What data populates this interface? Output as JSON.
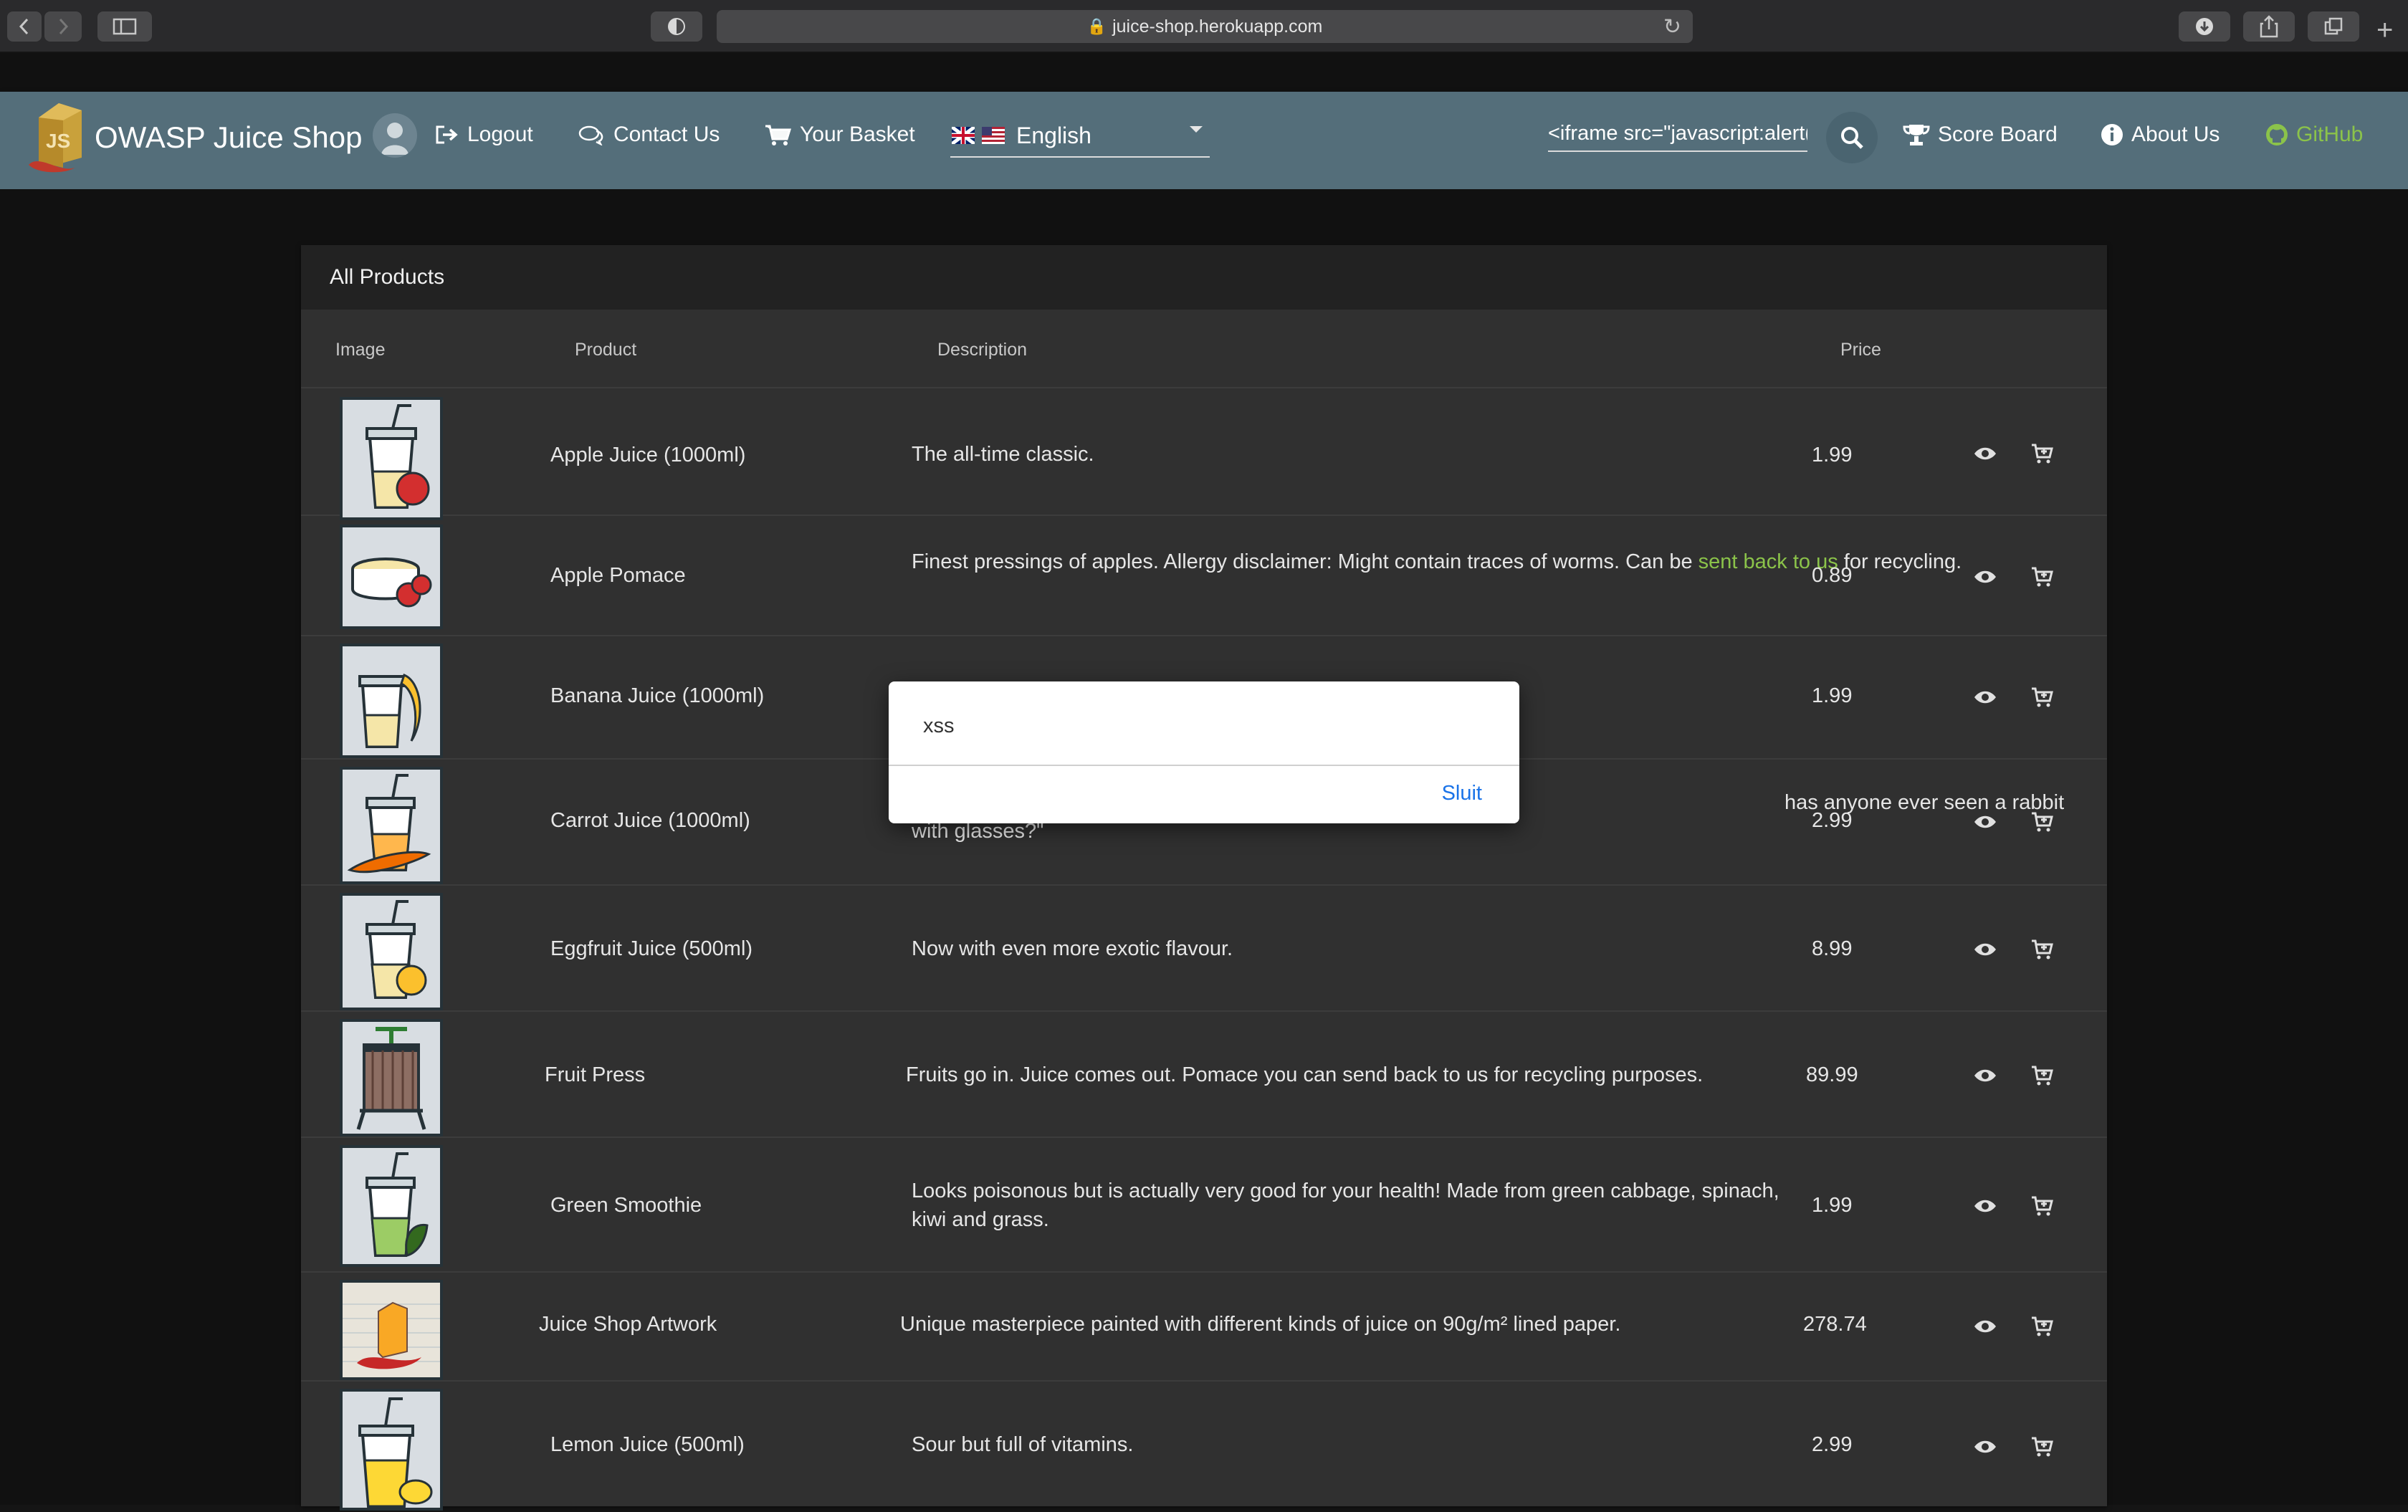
{
  "browser": {
    "url": "juice-shop.herokuapp.com"
  },
  "navbar": {
    "brand": "OWASP Juice Shop",
    "logout": "Logout",
    "contact": "Contact Us",
    "basket": "Your Basket",
    "language": "English",
    "search_value": "<iframe src=\"javascript:alert(",
    "score_board": "Score Board",
    "about": "About Us",
    "github": "GitHub"
  },
  "products": {
    "title": "All Products",
    "headers": [
      "Image",
      "Product",
      "Description",
      "Price"
    ],
    "rows": [
      {
        "name": "Apple Juice (1000ml)",
        "desc": "The all-time classic.",
        "price": "1.99"
      },
      {
        "name": "Apple Pomace",
        "desc": "Finest pressings of apples. Allergy disclaimer: Might contain traces of worms. Can be ",
        "desc_link": "sent back to us",
        "desc_after": " for recycling.",
        "price": "0.89"
      },
      {
        "name": "Banana Juice (1000ml)",
        "desc": "",
        "price": "1.99"
      },
      {
        "name": "Carrot Juice (1000ml)",
        "desc": "has anyone ever seen a rabbit",
        "desc_line2": "with glasses?\"",
        "price": "2.99"
      },
      {
        "name": "Eggfruit Juice (500ml)",
        "desc": "Now with even more exotic flavour.",
        "price": "8.99"
      },
      {
        "name": "Fruit Press",
        "desc": "Fruits go in. Juice comes out. Pomace you can send back to us for recycling purposes.",
        "price": "89.99"
      },
      {
        "name": "Green Smoothie",
        "desc": "Looks poisonous but is actually very good for your health! Made from green cabbage, spinach, kiwi and grass.",
        "price": "1.99"
      },
      {
        "name": "Juice Shop Artwork",
        "desc": "Unique masterpiece painted with different kinds of juice on 90g/m² lined paper.",
        "price": "278.74"
      },
      {
        "name": "Lemon Juice (500ml)",
        "desc": "Sour but full of vitamins.",
        "price": "2.99"
      }
    ]
  },
  "dialog": {
    "message": "xss",
    "button": "Sluit"
  },
  "colors": {
    "navbar": "#546e7a",
    "card": "#303030",
    "link": "#8bc34a",
    "github": "#8bc34a",
    "dialog_button": "#1a73e8"
  }
}
